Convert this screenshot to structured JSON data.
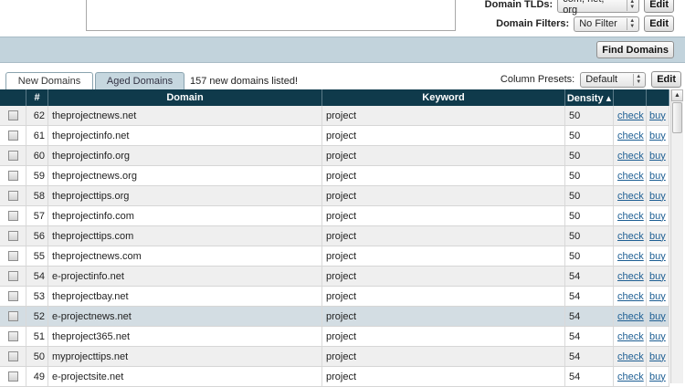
{
  "filters": {
    "tlds_label": "Domain TLDs:",
    "tlds_value": "com, net, org",
    "tlds_edit": "Edit",
    "filters_label": "Domain Filters:",
    "filters_value": "No Filter",
    "filters_edit": "Edit",
    "find_button": "Find Domains"
  },
  "tabs": {
    "new_label": "New Domains",
    "aged_label": "Aged Domains",
    "count_text": "157 new domains listed!"
  },
  "presets": {
    "label": "Column Presets:",
    "value": "Default",
    "edit": "Edit"
  },
  "table": {
    "headers": {
      "num": "#",
      "domain": "Domain",
      "keyword": "Keyword",
      "density": "Density ▴"
    },
    "check_label": "check",
    "buy_label": "buy",
    "rows": [
      {
        "num": "62",
        "domain": "theprojectnews.net",
        "keyword": "project",
        "density": "50"
      },
      {
        "num": "61",
        "domain": "theprojectinfo.net",
        "keyword": "project",
        "density": "50"
      },
      {
        "num": "60",
        "domain": "theprojectinfo.org",
        "keyword": "project",
        "density": "50"
      },
      {
        "num": "59",
        "domain": "theprojectnews.org",
        "keyword": "project",
        "density": "50"
      },
      {
        "num": "58",
        "domain": "theprojecttips.org",
        "keyword": "project",
        "density": "50"
      },
      {
        "num": "57",
        "domain": "theprojectinfo.com",
        "keyword": "project",
        "density": "50"
      },
      {
        "num": "56",
        "domain": "theprojecttips.com",
        "keyword": "project",
        "density": "50"
      },
      {
        "num": "55",
        "domain": "theprojectnews.com",
        "keyword": "project",
        "density": "50"
      },
      {
        "num": "54",
        "domain": "e-projectinfo.net",
        "keyword": "project",
        "density": "54"
      },
      {
        "num": "53",
        "domain": "theprojectbay.net",
        "keyword": "project",
        "density": "54"
      },
      {
        "num": "52",
        "domain": "e-projectnews.net",
        "keyword": "project",
        "density": "54"
      },
      {
        "num": "51",
        "domain": "theproject365.net",
        "keyword": "project",
        "density": "54"
      },
      {
        "num": "50",
        "domain": "myprojecttips.net",
        "keyword": "project",
        "density": "54"
      },
      {
        "num": "49",
        "domain": "e-projectsite.net",
        "keyword": "project",
        "density": "54"
      }
    ]
  },
  "colors": {
    "header_bg": "#0f3a4b",
    "band_bg": "#c2d3dc",
    "link": "#1d5e93",
    "highlight_row": "#d3dde3"
  }
}
